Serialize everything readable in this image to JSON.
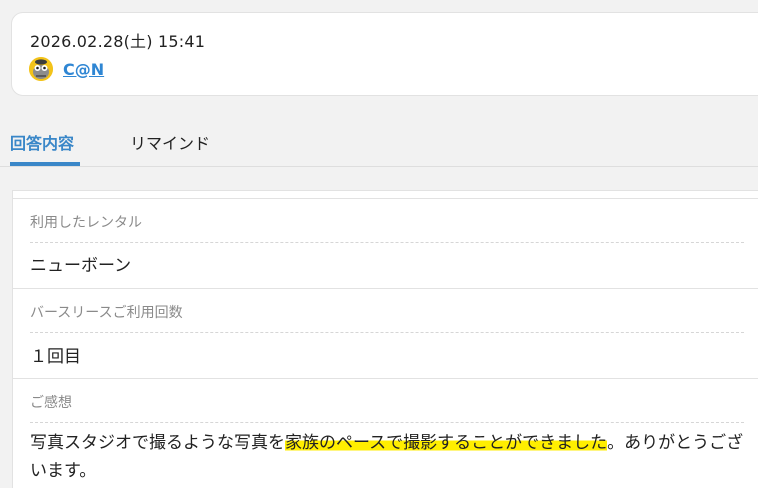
{
  "header": {
    "timestamp": "2026.02.28(土) 15:41",
    "username": "C@N",
    "avatar_icon": "character-avatar-icon"
  },
  "tabs": [
    {
      "label": "回答内容",
      "active": true
    },
    {
      "label": "リマインド",
      "active": false
    }
  ],
  "fields": {
    "rental": {
      "label": "利用したレンタル",
      "value": "ニューボーン"
    },
    "count": {
      "label": "バースリースご利用回数",
      "value": "１回目"
    },
    "comment": {
      "label": "ご感想",
      "before": "写真スタジオで撮るような写真を",
      "highlighted": "家族のペースで撮影することができました",
      "after": "。ありがとうございます。"
    }
  },
  "colors": {
    "accent": "#3a87c8",
    "link": "#2f86d3",
    "highlight": "#ffee00"
  }
}
